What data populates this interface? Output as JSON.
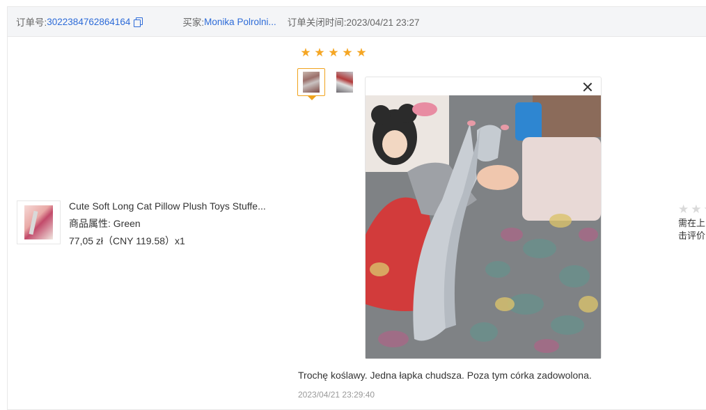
{
  "header": {
    "order_label": "订单号:",
    "order_number": "3022384762864164",
    "buyer_label": "买家:",
    "buyer_name": "Monika Polrolni...",
    "close_time": "订单关闭时间:2023/04/21 23:27"
  },
  "product": {
    "title": "Cute Soft Long Cat Pillow Plush Toys Stuffe...",
    "attribute": "商品属性:  Green",
    "price": "77,05 zł（CNY  119.58）x1"
  },
  "review": {
    "rating": 5,
    "photos": [
      "photo-1",
      "photo-2"
    ],
    "active_photo": 0,
    "text": "Trochę koślawy. Jedna łapka chudsza. Poza tym córka zadowolona.",
    "time": "2023/04/21 23:29:40"
  },
  "right_panel": {
    "rating": 0,
    "line1": "需在上",
    "line2": "击评价"
  },
  "colors": {
    "accent_link": "#2d6bd8",
    "star_filled": "#f5a623",
    "star_empty": "#d9d9d9",
    "active_border": "#f0a21b"
  }
}
